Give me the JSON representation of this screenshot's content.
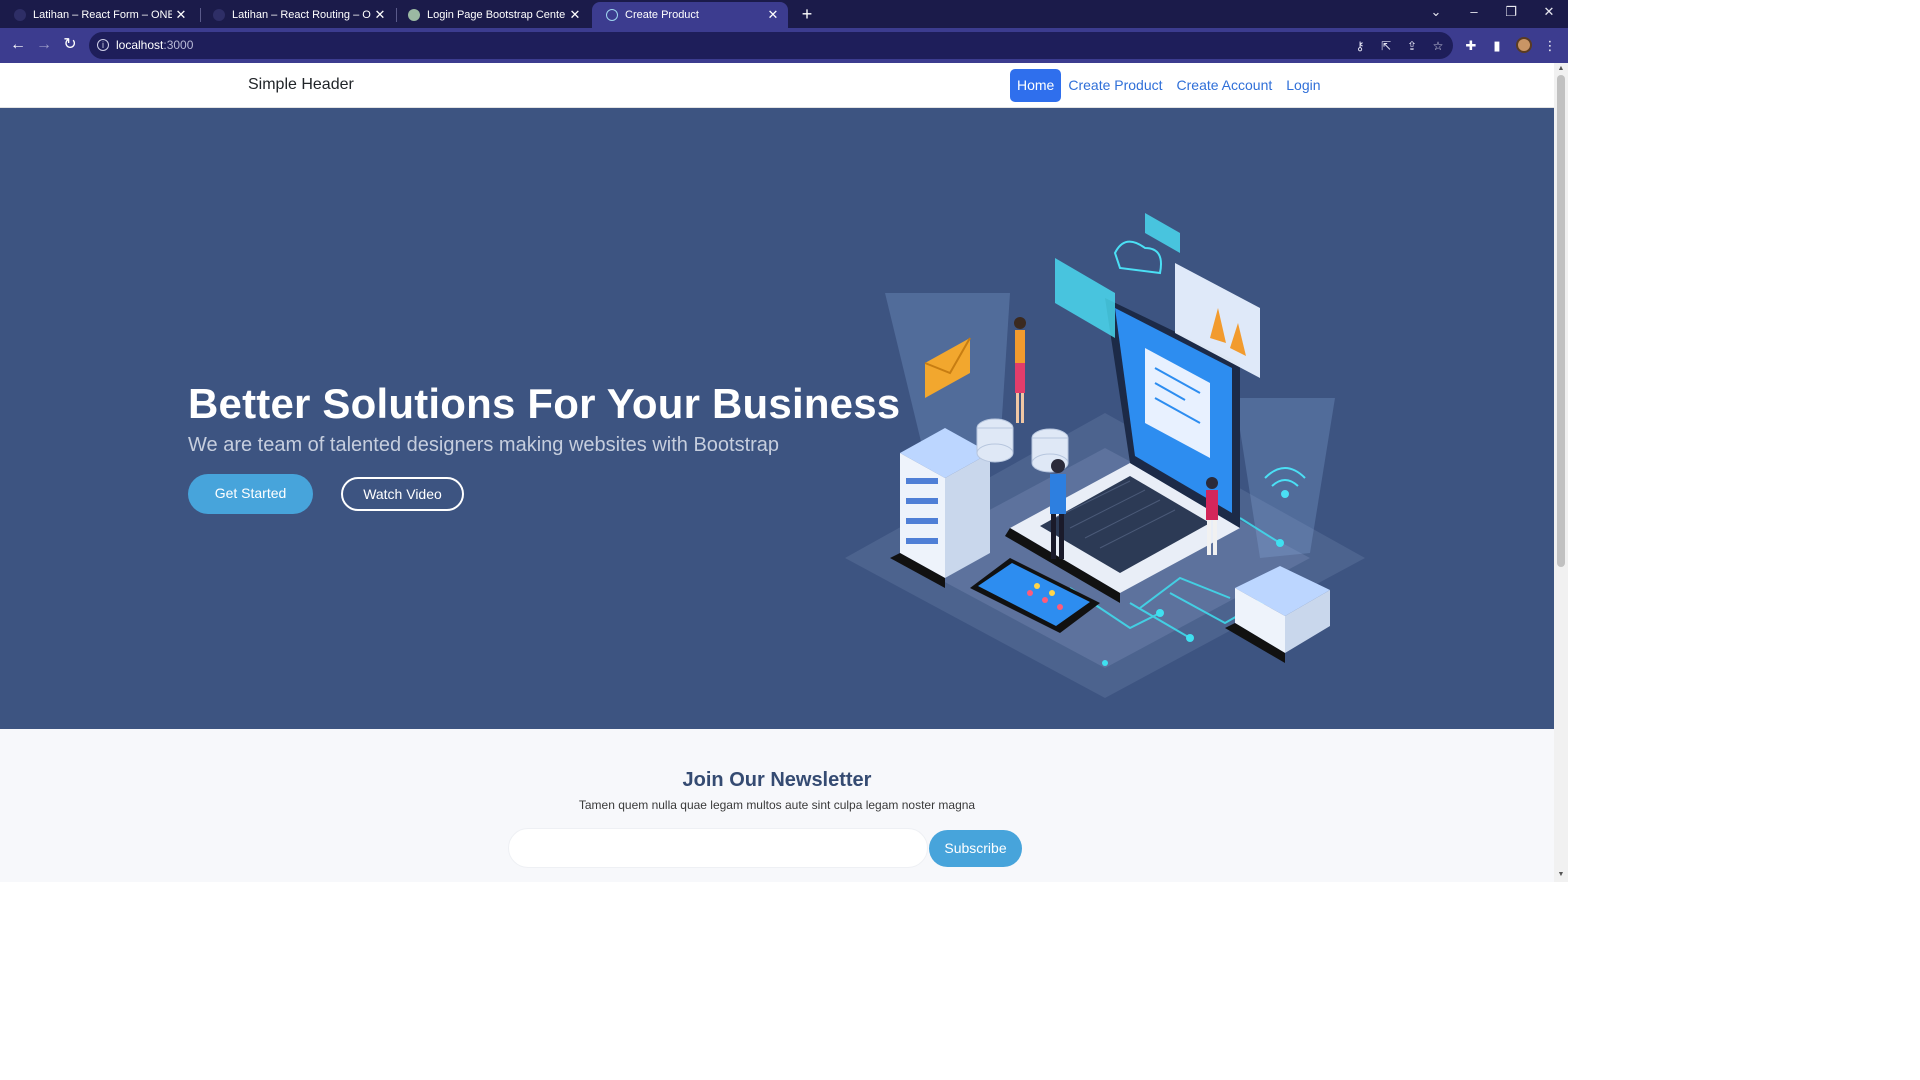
{
  "browser": {
    "tabs": [
      {
        "title": "Latihan – React Form – ONE by A",
        "active": false
      },
      {
        "title": "Latihan – React Routing – ONE b",
        "active": false
      },
      {
        "title": "Login Page Bootstrap Center",
        "active": false
      },
      {
        "title": "Create Product",
        "active": true
      }
    ],
    "new_tab": "+",
    "url_host": "localhost",
    "url_port": ":3000",
    "window_controls": {
      "minimize": "–",
      "restore": "❐",
      "close": "✕",
      "tab_search": "⌄"
    }
  },
  "site": {
    "brand": "Simple Header",
    "nav": [
      {
        "label": "Home",
        "active": true
      },
      {
        "label": "Create Product",
        "active": false
      },
      {
        "label": "Create Account",
        "active": false
      },
      {
        "label": "Login",
        "active": false
      }
    ]
  },
  "hero": {
    "title": "Better Solutions For Your Business",
    "subtitle": "We are team of talented designers making websites with Bootstrap",
    "primary_cta": "Get Started",
    "secondary_cta": "Watch Video",
    "illustration_icon": "isometric-laptop-illustration"
  },
  "newsletter": {
    "title": "Join Our Newsletter",
    "text": "Tamen quem nulla quae legam multos aute sint culpa legam noster magna",
    "email_placeholder": "",
    "button": "Subscribe"
  },
  "colors": {
    "browser_frame": "#1b1b4a",
    "browser_toolbar": "#3c3c8f",
    "hero_bg": "#3d5481",
    "accent": "#47a4db",
    "nav_active": "#2f6fed",
    "nav_link": "#2f6fd8"
  }
}
